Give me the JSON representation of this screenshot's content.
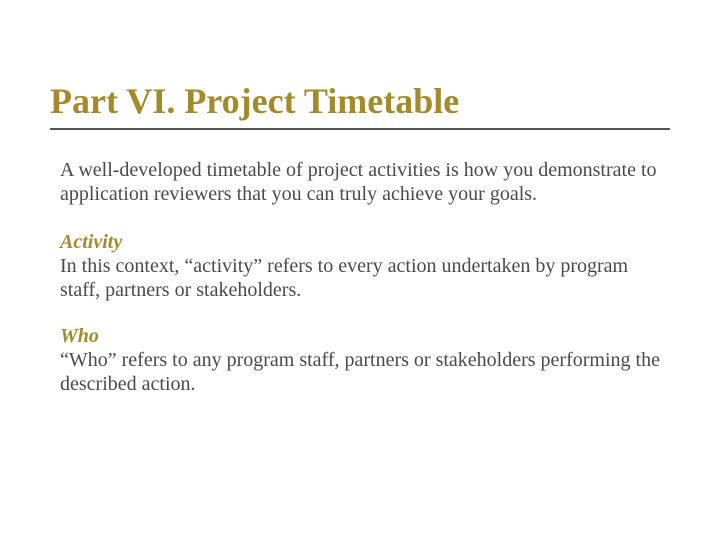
{
  "title": "Part VI.  Project Timetable",
  "intro": "A well-developed timetable of project activities is how you demonstrate to application reviewers that you can truly achieve your goals.",
  "sections": [
    {
      "label": "Activity",
      "body": "In this context, “activity” refers to every action undertaken by program staff, partners or stakeholders."
    },
    {
      "label": "Who",
      "body": "“Who” refers to any program staff, partners or stakeholders performing the described action."
    }
  ]
}
